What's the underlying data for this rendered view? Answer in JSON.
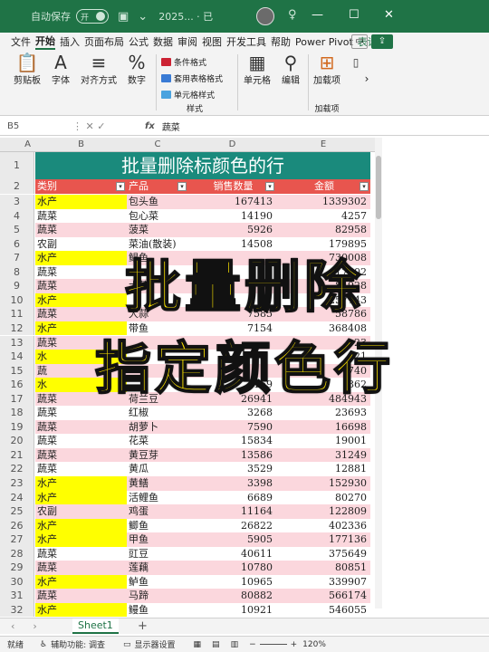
{
  "titlebar": {
    "autosave_label": "自动保存",
    "autosave_state": "开",
    "doc_title": "2025... · 已"
  },
  "menubar": {
    "tabs": [
      "文件",
      "开始",
      "插入",
      "页面布局",
      "公式",
      "数据",
      "审阅",
      "视图",
      "开发工具",
      "帮助",
      "Power Pivot",
      "表设计"
    ],
    "active_tab": "开始"
  },
  "ribbon": {
    "clipboard": "剪贴板",
    "font": "字体",
    "alignment": "对齐方式",
    "number": "数字",
    "conditional_format": "条件格式",
    "table_format": "套用表格格式",
    "cell_style": "单元格样式",
    "styles_group": "样式",
    "cells": "单元格",
    "editing": "编辑",
    "addins_button": "加载项",
    "addins_group": "加载项"
  },
  "formula_bar": {
    "cell_ref": "B5",
    "fx": "fx",
    "content": "蔬菜"
  },
  "columns": [
    "A",
    "B",
    "C",
    "D",
    "E"
  ],
  "sheet": {
    "banner_title": "批量删除标颜色的行",
    "headers": [
      "类别",
      "产品",
      "销售数量",
      "金额"
    ],
    "rows": [
      {
        "num": "3",
        "cat": "水产",
        "prod": "包头鱼",
        "qty": "167413",
        "amt": "1339302",
        "yellow": true
      },
      {
        "num": "4",
        "cat": "蔬菜",
        "prod": "包心菜",
        "qty": "14190",
        "amt": "4257",
        "yellow": false
      },
      {
        "num": "5",
        "cat": "蔬菜",
        "prod": "菠菜",
        "qty": "5926",
        "amt": "82958",
        "yellow": false
      },
      {
        "num": "6",
        "cat": "农副",
        "prod": "菜油(散装)",
        "qty": "14508",
        "amt": "179895",
        "yellow": false
      },
      {
        "num": "7",
        "cat": "水产",
        "prod": "鲳鱼",
        "qty": "",
        "amt": "730008",
        "yellow": true
      },
      {
        "num": "8",
        "cat": "蔬菜",
        "prod": "",
        "qty": "",
        "amt": "17502",
        "yellow": false
      },
      {
        "num": "9",
        "cat": "蔬菜",
        "prod": "大葱",
        "qty": "",
        "amt": "84928",
        "yellow": false
      },
      {
        "num": "10",
        "cat": "水产",
        "prod": "",
        "qty": "",
        "amt": "257743",
        "yellow": true
      },
      {
        "num": "11",
        "cat": "蔬菜",
        "prod": "大蒜",
        "qty": "7585",
        "amt": "58786",
        "yellow": false
      },
      {
        "num": "12",
        "cat": "水产",
        "prod": "带鱼",
        "qty": "7154",
        "amt": "368408",
        "yellow": true
      },
      {
        "num": "13",
        "cat": "蔬菜",
        "prod": "",
        "qty": "",
        "amt": "23",
        "yellow": false
      },
      {
        "num": "14",
        "cat": "水",
        "prod": "",
        "qty": "",
        "amt": "121",
        "yellow": true
      },
      {
        "num": "15",
        "cat": "蔬",
        "prod": "",
        "qty": "",
        "amt": "740",
        "yellow": false
      },
      {
        "num": "16",
        "cat": "水",
        "prod": "",
        "qty": "169",
        "amt": "862",
        "yellow": true
      },
      {
        "num": "17",
        "cat": "蔬菜",
        "prod": "荷兰豆",
        "qty": "26941",
        "amt": "484943",
        "yellow": false
      },
      {
        "num": "18",
        "cat": "蔬菜",
        "prod": "红椒",
        "qty": "3268",
        "amt": "23693",
        "yellow": false
      },
      {
        "num": "19",
        "cat": "蔬菜",
        "prod": "胡萝卜",
        "qty": "7590",
        "amt": "16698",
        "yellow": false
      },
      {
        "num": "20",
        "cat": "蔬菜",
        "prod": "花菜",
        "qty": "15834",
        "amt": "19001",
        "yellow": false
      },
      {
        "num": "21",
        "cat": "蔬菜",
        "prod": "黄豆芽",
        "qty": "13586",
        "amt": "31249",
        "yellow": false
      },
      {
        "num": "22",
        "cat": "蔬菜",
        "prod": "黄瓜",
        "qty": "3529",
        "amt": "12881",
        "yellow": false
      },
      {
        "num": "23",
        "cat": "水产",
        "prod": "黄鳝",
        "qty": "3398",
        "amt": "152930",
        "yellow": true
      },
      {
        "num": "24",
        "cat": "水产",
        "prod": "活鲤鱼",
        "qty": "6689",
        "amt": "80270",
        "yellow": true
      },
      {
        "num": "25",
        "cat": "农副",
        "prod": "鸡蛋",
        "qty": "11164",
        "amt": "122809",
        "yellow": false
      },
      {
        "num": "26",
        "cat": "水产",
        "prod": "鲫鱼",
        "qty": "26822",
        "amt": "402336",
        "yellow": true
      },
      {
        "num": "27",
        "cat": "水产",
        "prod": "甲鱼",
        "qty": "5905",
        "amt": "177136",
        "yellow": true
      },
      {
        "num": "28",
        "cat": "蔬菜",
        "prod": "豇豆",
        "qty": "40611",
        "amt": "375649",
        "yellow": false
      },
      {
        "num": "29",
        "cat": "蔬菜",
        "prod": "莲藕",
        "qty": "10780",
        "amt": "80851",
        "yellow": false
      },
      {
        "num": "30",
        "cat": "水产",
        "prod": "鲈鱼",
        "qty": "10965",
        "amt": "339907",
        "yellow": true
      },
      {
        "num": "31",
        "cat": "蔬菜",
        "prod": "马蹄",
        "qty": "80882",
        "amt": "566174",
        "yellow": false
      },
      {
        "num": "32",
        "cat": "水产",
        "prod": "鳗鱼",
        "qty": "10921",
        "amt": "546055",
        "yellow": true
      }
    ]
  },
  "overlay": {
    "line1": "批量删除",
    "line2": "指定颜色行"
  },
  "sheettabs": {
    "active": "Sheet1",
    "add": "+"
  },
  "statusbar": {
    "ready": "就绪",
    "accessibility": "辅助功能: 调查",
    "display": "显示器设置",
    "zoom": "120%"
  },
  "colors": {
    "excel_green": "#1f7346",
    "banner": "#1a8a7c",
    "header_red": "#e8554e",
    "row_pink": "#fbd7dd",
    "highlight_yellow": "#ffff00",
    "overlay_yellow": "#ffe600"
  }
}
